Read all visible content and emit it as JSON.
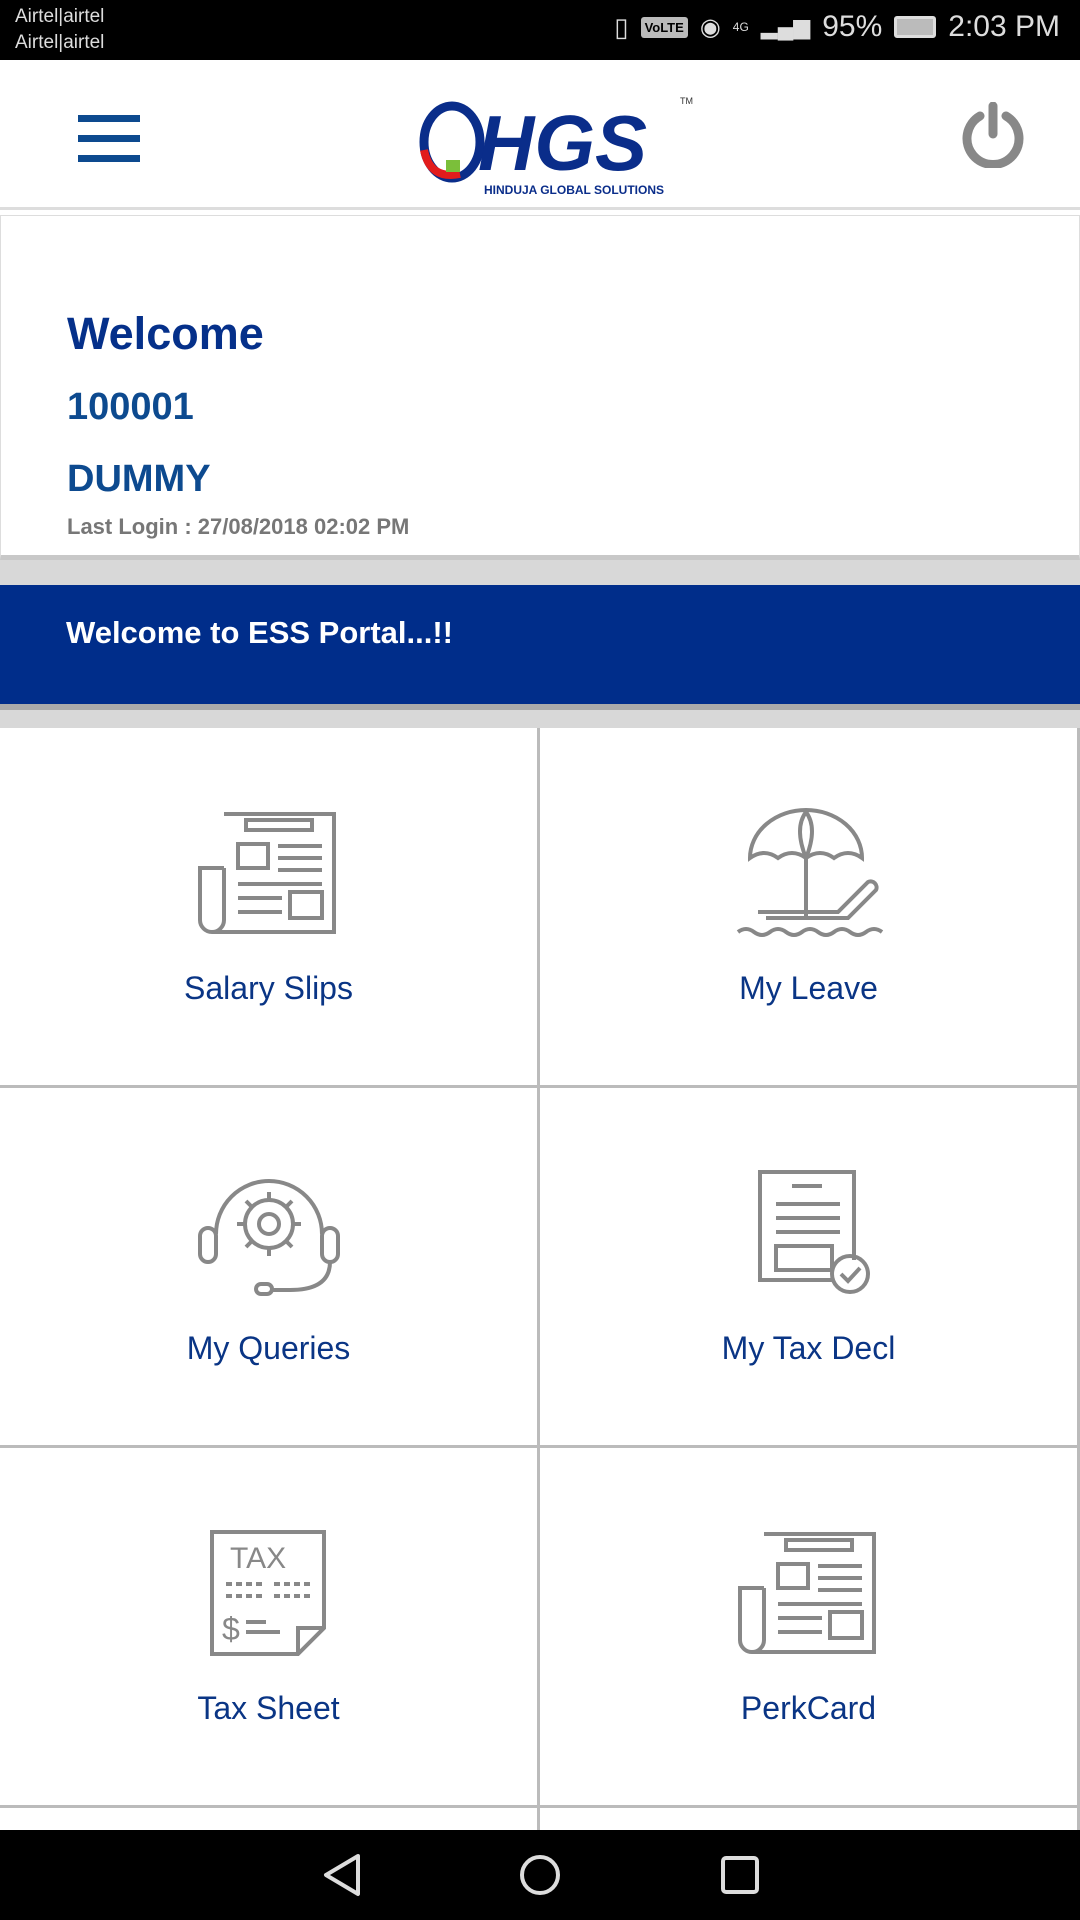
{
  "status_bar": {
    "carrier_1": "Airtel|airtel",
    "carrier_2": "Airtel|airtel",
    "volte": "VoLTE",
    "network": "4G",
    "battery": "95%",
    "time": "2:03 PM"
  },
  "header": {
    "logo_text": "HGS",
    "logo_subtitle": "HINDUJA GLOBAL SOLUTIONS",
    "menu_icon": "hamburger-icon",
    "power_icon": "power-icon"
  },
  "profile": {
    "welcome": "Welcome",
    "employee_id": "100001",
    "employee_name": "DUMMY",
    "last_login": "Last Login : 27/08/2018 02:02 PM"
  },
  "banner": {
    "text": "Welcome to ESS Portal...!!"
  },
  "tiles": [
    {
      "label": "Salary Slips",
      "icon": "newspaper-icon"
    },
    {
      "label": "My Leave",
      "icon": "beach-umbrella-icon"
    },
    {
      "label": "My Queries",
      "icon": "headset-gear-icon"
    },
    {
      "label": "My Tax Decl",
      "icon": "document-check-icon"
    },
    {
      "label": "Tax Sheet",
      "icon": "tax-document-icon"
    },
    {
      "label": "PerkCard",
      "icon": "newspaper-icon"
    }
  ],
  "colors": {
    "brand_blue": "#002d8a",
    "text_blue": "#0d4a8f",
    "icon_gray": "#888888"
  }
}
